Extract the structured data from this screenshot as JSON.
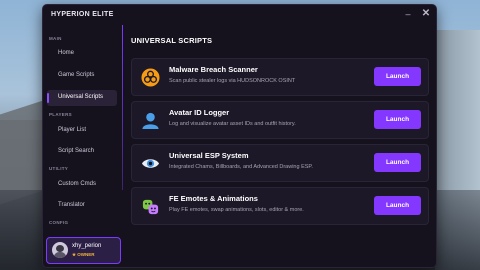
{
  "window": {
    "title": "HYPERION ELITE"
  },
  "sidebar": {
    "sections": [
      "MAIN",
      "PLAYERS",
      "UTILITY",
      "CONFIG"
    ],
    "items": [
      {
        "label": "Home"
      },
      {
        "label": "Game Scripts"
      },
      {
        "label": "Universal Scripts",
        "active": true
      },
      {
        "label": "Player List"
      },
      {
        "label": "Script Search"
      },
      {
        "label": "Custom Cmds"
      },
      {
        "label": "Translator"
      }
    ]
  },
  "user": {
    "name": "xhy_perion",
    "role": "OWNER"
  },
  "main": {
    "title": "UNIVERSAL SCRIPTS",
    "scripts": [
      {
        "title": "Malware Breach Scanner",
        "description": "Scan public stealer logs via HUDSONROCK OSINT",
        "button": "Launch",
        "icon": "biohazard-icon"
      },
      {
        "title": "Avatar ID Logger",
        "description": "Log and visualize avatar asset IDs and outfit history.",
        "button": "Launch",
        "icon": "user-icon"
      },
      {
        "title": "Universal ESP System",
        "description": "Integrated Chams, Billboards, and Advanced Drawing ESP.",
        "button": "Launch",
        "icon": "eye-icon"
      },
      {
        "title": "FE Emotes & Animations",
        "description": "Play FE emotes, swap animations, slots, editor & more.",
        "button": "Launch",
        "icon": "emotes-icon"
      }
    ]
  },
  "colors": {
    "accent": "#8438ff",
    "background": "#15121e",
    "card": "#1c1827",
    "owner": "#f2b53a"
  }
}
